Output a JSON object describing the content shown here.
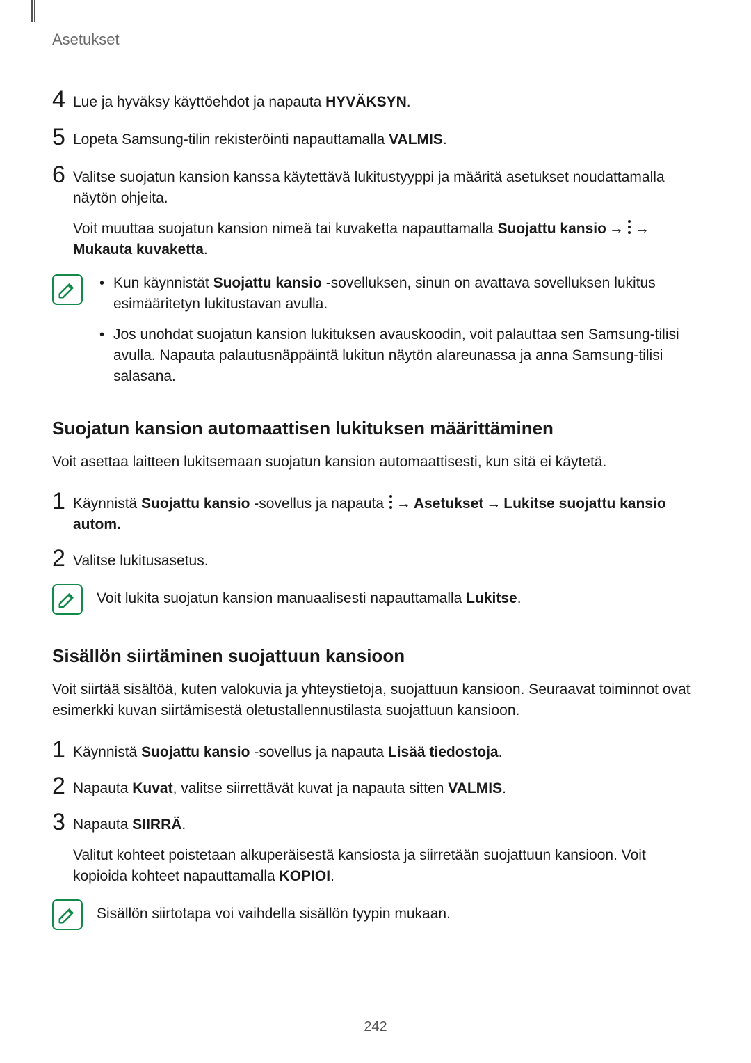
{
  "header": {
    "title": "Asetukset"
  },
  "steps_a": {
    "s4": {
      "num": "4",
      "pre": "Lue ja hyväksy käyttöehdot ja napauta ",
      "bold": "HYVÄKSYN",
      "post": "."
    },
    "s5": {
      "num": "5",
      "pre": "Lopeta Samsung-tilin rekisteröinti napauttamalla ",
      "bold": "VALMIS",
      "post": "."
    },
    "s6": {
      "num": "6",
      "p1": "Valitse suojatun kansion kanssa käytettävä lukitustyyppi ja määritä asetukset noudattamalla näytön ohjeita.",
      "p2_pre": "Voit muuttaa suojatun kansion nimeä tai kuvaketta napauttamalla ",
      "p2_b1": "Suojattu kansio",
      "p2_arrow1": " → ",
      "p2_arrow2": " → ",
      "p2_b2": "Mukauta kuvaketta",
      "p2_post": "."
    }
  },
  "note1": {
    "li1_pre": "Kun käynnistät ",
    "li1_b": "Suojattu kansio",
    "li1_post": " -sovelluksen, sinun on avattava sovelluksen lukitus esimääritetyn lukitustavan avulla.",
    "li2": "Jos unohdat suojatun kansion lukituksen avauskoodin, voit palauttaa sen Samsung-tilisi avulla. Napauta palautusnäppäintä lukitun näytön alareunassa ja anna Samsung-tilisi salasana."
  },
  "sectionB": {
    "title": "Suojatun kansion automaattisen lukituksen määrittäminen",
    "lead": "Voit asettaa laitteen lukitsemaan suojatun kansion automaattisesti, kun sitä ei käytetä.",
    "s1": {
      "num": "1",
      "pre": "Käynnistä ",
      "b1": "Suojattu kansio",
      "mid1": " -sovellus ja napauta ",
      "arrow1": " → ",
      "b2": "Asetukset",
      "arrow2": " → ",
      "b3": "Lukitse suojattu kansio autom."
    },
    "s2": {
      "num": "2",
      "text": "Valitse lukitusasetus."
    }
  },
  "note2": {
    "pre": "Voit lukita suojatun kansion manuaalisesti napauttamalla ",
    "b": "Lukitse",
    "post": "."
  },
  "sectionC": {
    "title": "Sisällön siirtäminen suojattuun kansioon",
    "lead": "Voit siirtää sisältöä, kuten valokuvia ja yhteystietoja, suojattuun kansioon. Seuraavat toiminnot ovat esimerkki kuvan siirtämisestä oletustallennustilasta suojattuun kansioon.",
    "s1": {
      "num": "1",
      "pre": "Käynnistä ",
      "b1": "Suojattu kansio",
      "mid": " -sovellus ja napauta ",
      "b2": "Lisää tiedostoja",
      "post": "."
    },
    "s2": {
      "num": "2",
      "pre": "Napauta ",
      "b1": "Kuvat",
      "mid": ", valitse siirrettävät kuvat ja napauta sitten ",
      "b2": "VALMIS",
      "post": "."
    },
    "s3": {
      "num": "3",
      "p1_pre": "Napauta ",
      "p1_b": "SIIRRÄ",
      "p1_post": ".",
      "p2_pre": "Valitut kohteet poistetaan alkuperäisestä kansiosta ja siirretään suojattuun kansioon. Voit kopioida kohteet napauttamalla ",
      "p2_b": "KOPIOI",
      "p2_post": "."
    }
  },
  "note3": {
    "text": "Sisällön siirtotapa voi vaihdella sisällön tyypin mukaan."
  },
  "footer": {
    "page_number": "242"
  }
}
